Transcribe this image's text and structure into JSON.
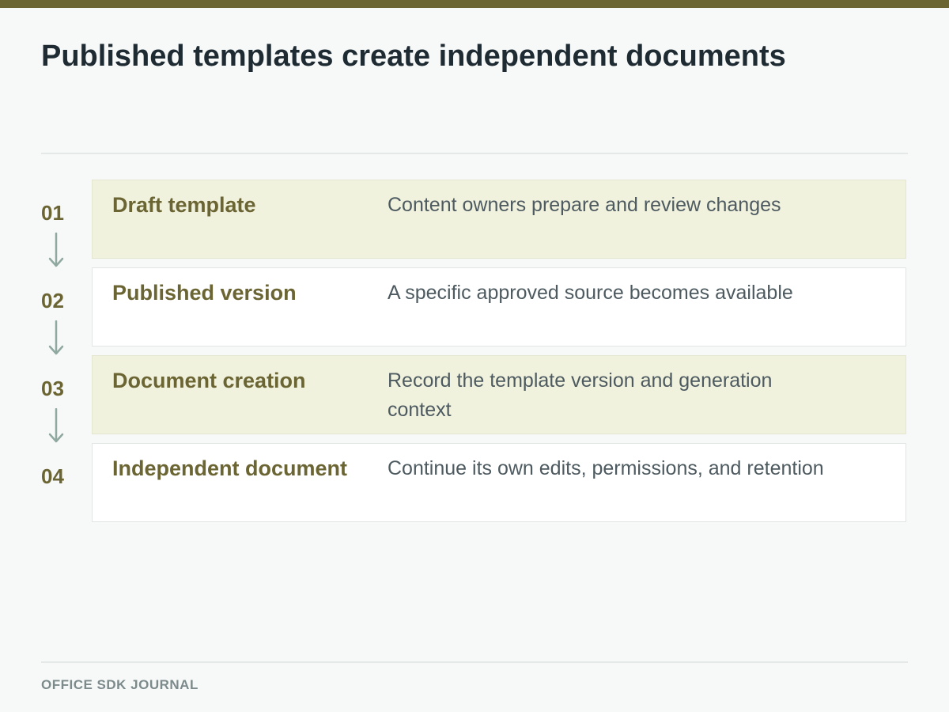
{
  "title": "Published templates create independent documents",
  "steps": [
    {
      "number": "01",
      "title": "Draft template",
      "description": "Content owners prepare and review changes"
    },
    {
      "number": "02",
      "title": "Published version",
      "description": "A specific approved source becomes available"
    },
    {
      "number": "03",
      "title": "Document creation",
      "description": "Record the template version and generation context"
    },
    {
      "number": "04",
      "title": "Independent document",
      "description": "Continue its own edits, permissions, and retention"
    }
  ],
  "footer": "OFFICE SDK JOURNAL",
  "colors": {
    "accent": "#6b6433",
    "tinted_card": "#f1f2de",
    "arrow": "#8fa8a0"
  }
}
